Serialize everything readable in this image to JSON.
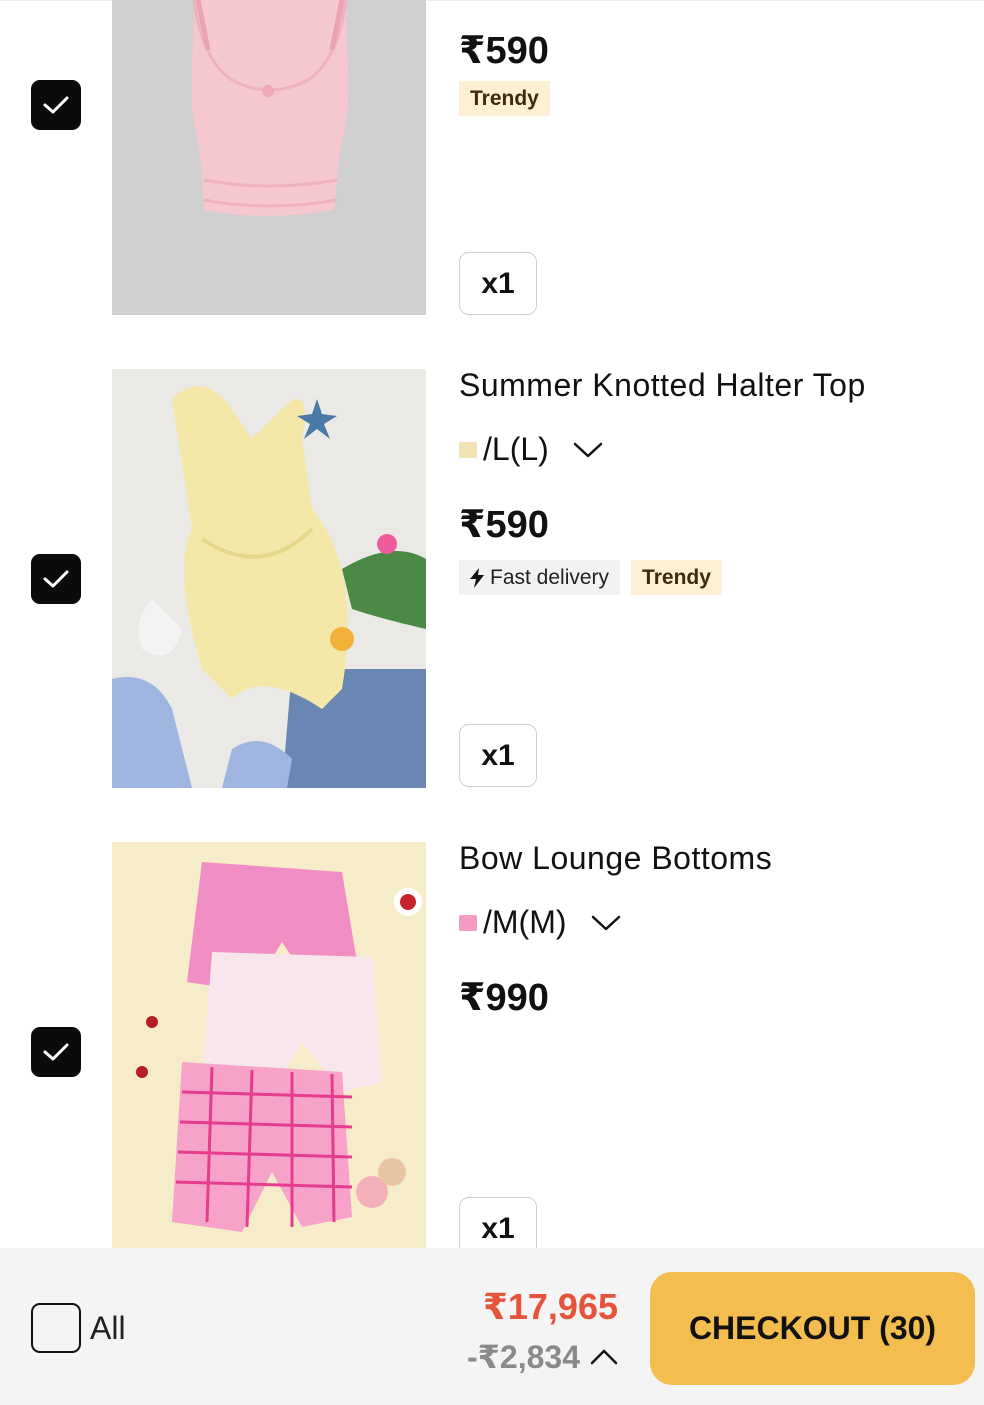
{
  "colors": {
    "checkbox_checked": "#0b0b0b",
    "trendy_tag_bg": "#fdf0d4",
    "total_red": "#e5533b",
    "checkout_yellow": "#f4bd4f"
  },
  "items": [
    {
      "checked": true,
      "image_desc": "pink-cami-top",
      "price": "₹590",
      "tags": [
        "Trendy"
      ],
      "quantity": "x1"
    },
    {
      "checked": true,
      "image_desc": "yellow-halter-top",
      "title": "Summer Knotted Halter Top",
      "variant": "/L(L)",
      "price": "₹590",
      "tags": [
        "Fast delivery",
        "Trendy"
      ],
      "quantity": "x1"
    },
    {
      "checked": true,
      "image_desc": "pink-plaid-shorts-set",
      "title": "Bow Lounge Bottoms",
      "variant": "/M(M)",
      "price": "₹990",
      "quantity": "x1"
    }
  ],
  "footer": {
    "select_all_label": "All",
    "total": "₹17,965",
    "discount": "-₹2,834",
    "checkout_label": "CHECKOUT (30)"
  }
}
